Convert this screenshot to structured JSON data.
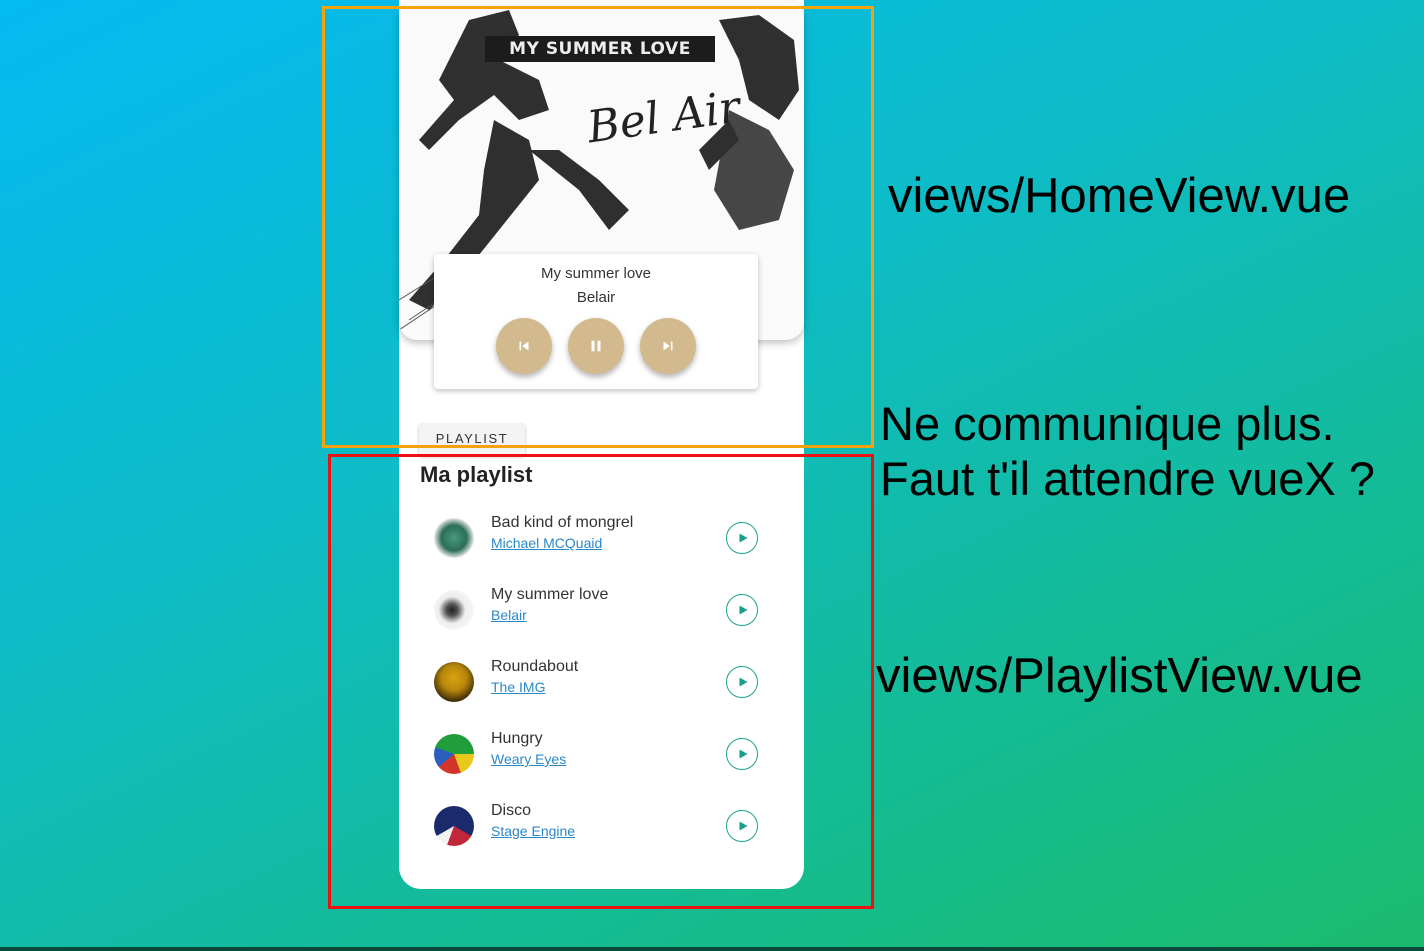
{
  "cover": {
    "banner_text": "MY SUMMER LOVE",
    "script_text": "Bel Air",
    "image": "dancing-couple-album-art"
  },
  "player": {
    "song_title": "My summer love",
    "artist": "Belair",
    "controls": [
      {
        "name": "previous-button",
        "icon": "skip-previous-icon"
      },
      {
        "name": "pause-button",
        "icon": "pause-icon"
      },
      {
        "name": "next-button",
        "icon": "skip-next-icon"
      }
    ],
    "control_color": "#d2b98e"
  },
  "playlist_button": "PLAYLIST",
  "playlist_title": "Ma playlist",
  "tracks": [
    {
      "title": "Bad kind of mongrel",
      "artist": "Michael MCQuaid",
      "icon": "play-icon"
    },
    {
      "title": "My summer love",
      "artist": "Belair",
      "icon": "play-icon"
    },
    {
      "title": "Roundabout",
      "artist": "The IMG",
      "icon": "play-icon"
    },
    {
      "title": "Hungry",
      "artist": "Weary Eyes",
      "icon": "play-icon"
    },
    {
      "title": "Disco",
      "artist": "Stage Engine",
      "icon": "play-icon"
    }
  ],
  "annotations": {
    "home_label": "views/HomeView.vue",
    "question_line1": "Ne communique plus.",
    "question_line2": "Faut t'il attendre vueX ?",
    "playlist_label": "views/PlaylistView.vue",
    "home_box_color": "#f5a30a",
    "playlist_box_color": "#ee1111"
  },
  "colors": {
    "accent": "#1aa18a",
    "link": "#2a88c8"
  }
}
